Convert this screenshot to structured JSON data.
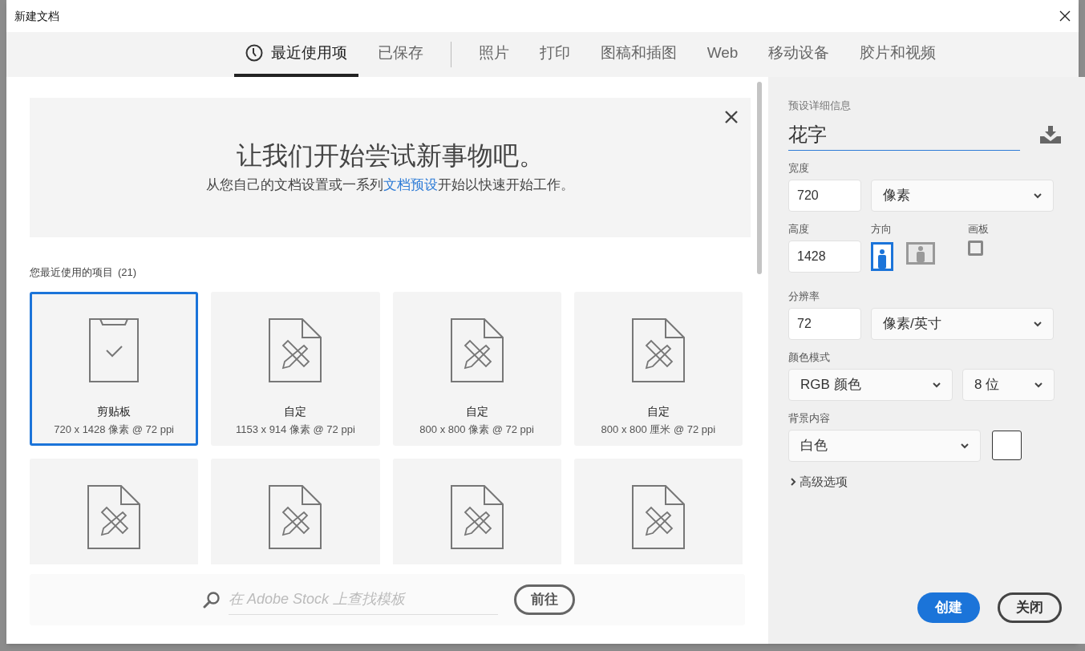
{
  "window": {
    "title": "新建文档"
  },
  "tab_groups": [
    [
      {
        "label": "最近使用项",
        "kind": "recent",
        "selected": true
      },
      {
        "label": "已保存",
        "kind": "plain",
        "selected": false
      }
    ],
    [
      {
        "label": "照片",
        "kind": "plain",
        "selected": false
      },
      {
        "label": "打印",
        "kind": "plain",
        "selected": false
      },
      {
        "label": "图稿和插图",
        "kind": "plain",
        "selected": false
      },
      {
        "label": "Web",
        "kind": "plain",
        "selected": false
      },
      {
        "label": "移动设备",
        "kind": "plain",
        "selected": false
      },
      {
        "label": "胶片和视频",
        "kind": "plain",
        "selected": false
      }
    ]
  ],
  "banner": {
    "heading": "让我们开始尝试新事物吧。",
    "text_before": "从您自己的文档设置或一系列",
    "link": "文档预设",
    "text_after": "开始以快速开始工作。"
  },
  "recent": {
    "title": "您最近使用的项目",
    "count": "(21)",
    "items": [
      {
        "kind": "clipboard",
        "name": "剪贴板",
        "size": "720 x 1428 像素 @ 72 ppi",
        "selected": true
      },
      {
        "kind": "custom",
        "name": "自定",
        "size": "1153 x 914 像素 @ 72 ppi",
        "selected": false
      },
      {
        "kind": "custom",
        "name": "自定",
        "size": "800 x 800 像素 @ 72 ppi",
        "selected": false
      },
      {
        "kind": "custom",
        "name": "自定",
        "size": "800 x 800 厘米 @ 72 ppi",
        "selected": false
      },
      {
        "kind": "custom",
        "selected": false
      },
      {
        "kind": "custom",
        "selected": false
      },
      {
        "kind": "custom",
        "selected": false
      },
      {
        "kind": "custom",
        "selected": false
      }
    ]
  },
  "stock_search": {
    "placeholder": "在 Adobe Stock 上查找模板",
    "button": "前往"
  },
  "preset": {
    "title": "预设详细信息",
    "name": "花字",
    "width": {
      "label": "宽度",
      "value": "720",
      "unit": "像素"
    },
    "height": {
      "label": "高度",
      "value": "1428"
    },
    "orientation": {
      "label": "方向",
      "options": [
        {
          "kind": "portrait",
          "selected": true
        },
        {
          "kind": "landscape",
          "selected": false
        }
      ]
    },
    "artboard": {
      "label": "画板",
      "checked": false
    },
    "resolution": {
      "label": "分辨率",
      "value": "72",
      "unit": "像素/英寸"
    },
    "color_mode": {
      "label": "颜色模式",
      "mode": "RGB 颜色",
      "depth": "8 位"
    },
    "background": {
      "label": "背景内容",
      "value": "白色",
      "color": "#ffffff"
    },
    "advanced": {
      "label": "高级选项",
      "expanded": false
    }
  },
  "buttons": {
    "create": "创建",
    "close": "关闭"
  }
}
